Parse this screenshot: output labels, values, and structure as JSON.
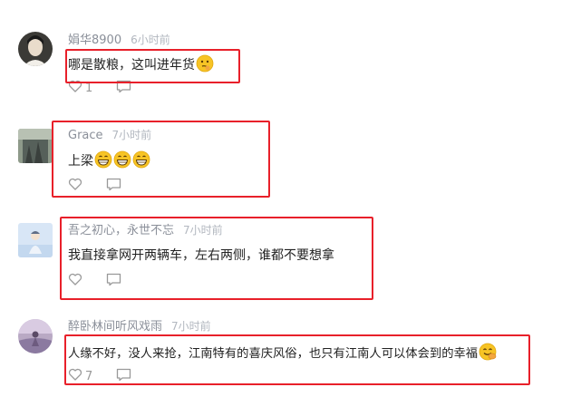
{
  "comments": [
    {
      "user": "娟华8900",
      "time": "6小时前",
      "text": "哪是散粮，这叫进年货",
      "emoji": "thinking-face",
      "like_count": "1"
    },
    {
      "user": "Grace",
      "time": "7小时前",
      "text": "上梁",
      "emoji": "grinning-face",
      "emoji_count": 3
    },
    {
      "user": "吾之初心，永世不忘",
      "time": "7小时前",
      "text": "我直接拿网开两辆车，左右两侧，谁都不要想拿"
    },
    {
      "user": "醉卧林间听风戏雨",
      "time": "7小时前",
      "text": "人缘不好，没人来抢，江南特有的喜庆风俗，也只有江南人可以体会到的幸福",
      "emoji": "laughing-hand-face",
      "like_count": "7"
    }
  ],
  "icons": {
    "like": "heart-icon",
    "reply": "comment-icon"
  },
  "colors": {
    "highlight": "#e8202a",
    "username": "#8a8f99",
    "timestamp": "#b2b7bf",
    "text": "#222222",
    "icon": "#999999"
  }
}
